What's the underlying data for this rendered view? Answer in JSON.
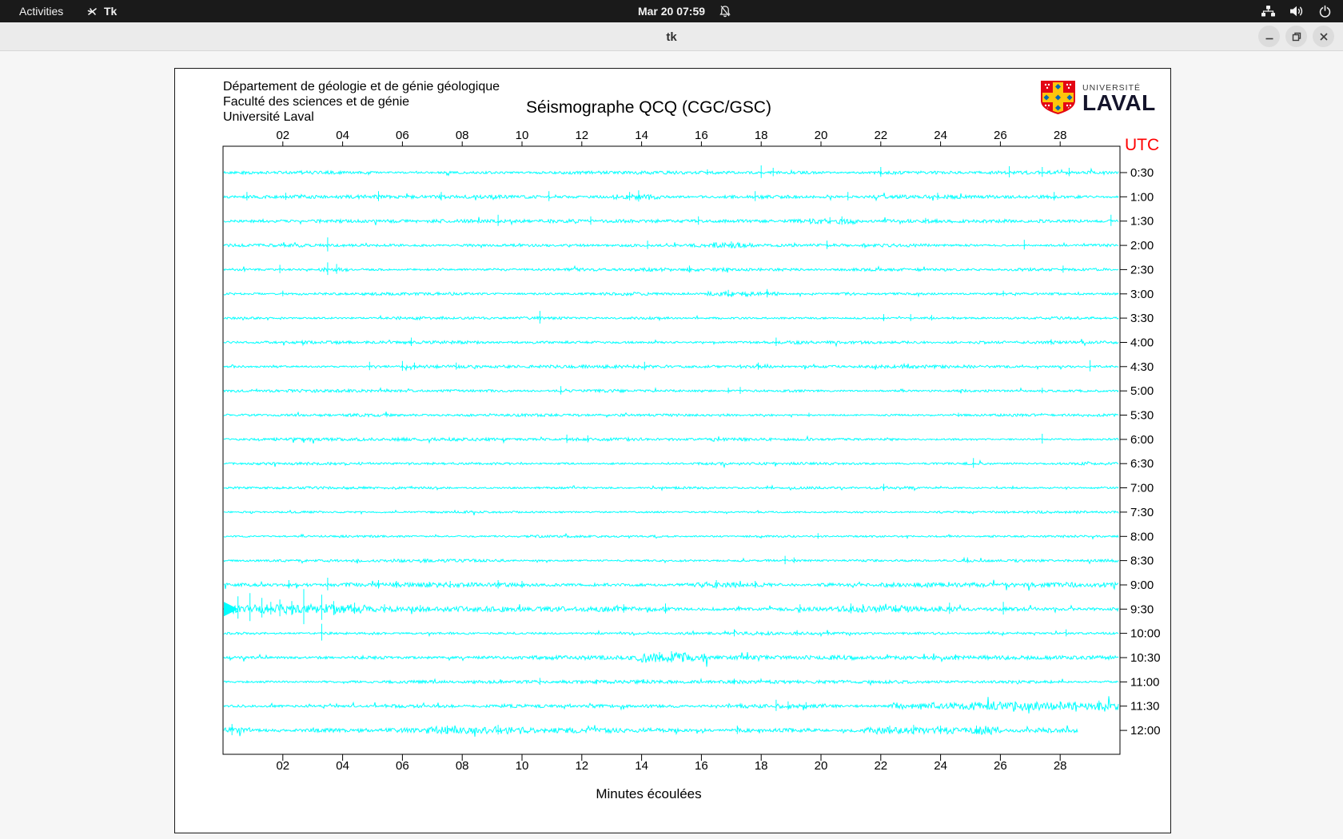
{
  "topbar": {
    "activities": "Activities",
    "app_name": "Tk",
    "clock": "Mar 20 07:59",
    "icons": [
      "tk-app-icon",
      "bell-muted-icon",
      "network-icon",
      "volume-icon",
      "power-icon"
    ]
  },
  "window": {
    "title": "tk",
    "buttons": [
      "minimize",
      "restore",
      "close"
    ]
  },
  "seismograph": {
    "org_lines": [
      "Département de géologie et de génie géologique",
      "Faculté des sciences et de génie",
      "Université Laval"
    ],
    "title": "Séismographe QCQ (CGC/GSC)",
    "utc_label": "UTC",
    "xlabel": "Minutes écoulées",
    "logo": {
      "line1": "UNIVERSITÉ",
      "line2": "LAVAL"
    },
    "colors": {
      "trace": "#00ffff",
      "utc": "#ff0000",
      "logo_red": "#e30513",
      "logo_gold": "#ffc40c",
      "logo_blue": "#0067b1"
    }
  },
  "chart_data": {
    "type": "line",
    "subtype": "seismogram-helicorder",
    "title": "Séismographe QCQ (CGC/GSC)",
    "xlabel": "Minutes écoulées",
    "right_axis_label": "UTC",
    "x_axis": {
      "ticks": [
        "02",
        "04",
        "06",
        "08",
        "10",
        "12",
        "14",
        "16",
        "18",
        "20",
        "22",
        "24",
        "26",
        "28"
      ],
      "range_minutes": [
        0,
        30
      ]
    },
    "rows": [
      {
        "time": "0:30",
        "base_amp": 1.4,
        "spikes": [
          [
            16.2,
            4
          ],
          [
            18.0,
            9
          ],
          [
            18.4,
            6
          ],
          [
            22.0,
            7
          ],
          [
            26.3,
            8
          ],
          [
            27.4,
            7
          ],
          [
            28.3,
            6
          ]
        ],
        "boosts": []
      },
      {
        "time": "1:00",
        "base_amp": 1.5,
        "spikes": [
          [
            0.8,
            6
          ],
          [
            2.1,
            5
          ],
          [
            5.2,
            7
          ],
          [
            7.3,
            6
          ],
          [
            10.9,
            7
          ],
          [
            13.6,
            6
          ],
          [
            13.9,
            8
          ],
          [
            17.8,
            7
          ],
          [
            20.9,
            6
          ],
          [
            23.9,
            5
          ],
          [
            27.8,
            6
          ]
        ],
        "boosts": [
          [
            13.0,
            14.6,
            2.2
          ]
        ]
      },
      {
        "time": "1:30",
        "base_amp": 1.4,
        "spikes": [
          [
            9.2,
            8
          ],
          [
            12.3,
            6
          ],
          [
            15.9,
            6
          ],
          [
            20.3,
            5
          ],
          [
            20.7,
            6
          ],
          [
            23.5,
            4
          ],
          [
            29.7,
            8
          ]
        ],
        "boosts": [
          [
            19.6,
            21.2,
            2.2
          ]
        ]
      },
      {
        "time": "2:00",
        "base_amp": 1.4,
        "spikes": [
          [
            3.5,
            10
          ],
          [
            14.2,
            6
          ],
          [
            17.0,
            5
          ],
          [
            20.2,
            6
          ],
          [
            26.8,
            7
          ]
        ],
        "boosts": [
          [
            16.4,
            17.8,
            2.2
          ]
        ]
      },
      {
        "time": "2:30",
        "base_amp": 1.4,
        "spikes": [
          [
            1.9,
            6
          ],
          [
            3.5,
            9
          ],
          [
            3.8,
            7
          ],
          [
            15.6,
            5
          ],
          [
            28.1,
            5
          ]
        ],
        "boosts": [
          [
            3.2,
            4.2,
            1.5
          ]
        ]
      },
      {
        "time": "3:00",
        "base_amp": 1.4,
        "spikes": [
          [
            2.0,
            4
          ],
          [
            16.9,
            5
          ],
          [
            18.2,
            6
          ],
          [
            26.1,
            4
          ]
        ],
        "boosts": [
          [
            16.2,
            18.6,
            2.0
          ]
        ]
      },
      {
        "time": "3:30",
        "base_amp": 1.3,
        "spikes": [
          [
            10.6,
            9
          ],
          [
            22.1,
            5
          ],
          [
            23.0,
            5
          ],
          [
            23.7,
            4
          ]
        ],
        "boosts": []
      },
      {
        "time": "4:00",
        "base_amp": 1.3,
        "spikes": [
          [
            6.3,
            6
          ],
          [
            18.5,
            6
          ],
          [
            27.7,
            4
          ]
        ],
        "boosts": []
      },
      {
        "time": "4:30",
        "base_amp": 1.4,
        "spikes": [
          [
            4.9,
            6
          ],
          [
            6.0,
            7
          ],
          [
            6.4,
            5
          ],
          [
            7.8,
            5
          ],
          [
            14.1,
            6
          ],
          [
            17.9,
            5
          ],
          [
            29.0,
            8
          ]
        ],
        "boosts": [
          [
            17.2,
            18.4,
            2.0
          ]
        ]
      },
      {
        "time": "5:00",
        "base_amp": 1.3,
        "spikes": [
          [
            11.3,
            6
          ],
          [
            16.9,
            4
          ],
          [
            17.3,
            5
          ],
          [
            27.4,
            4
          ]
        ],
        "boosts": []
      },
      {
        "time": "5:30",
        "base_amp": 1.2,
        "spikes": [
          [
            19.6,
            3
          ],
          [
            24.6,
            3
          ]
        ],
        "boosts": []
      },
      {
        "time": "6:00",
        "base_amp": 1.3,
        "spikes": [
          [
            11.5,
            6
          ],
          [
            12.2,
            5
          ],
          [
            27.4,
            7
          ]
        ],
        "boosts": []
      },
      {
        "time": "6:30",
        "base_amp": 1.2,
        "spikes": [
          [
            25.1,
            7
          ]
        ],
        "boosts": []
      },
      {
        "time": "7:00",
        "base_amp": 1.2,
        "spikes": [
          [
            22.1,
            5
          ]
        ],
        "boosts": []
      },
      {
        "time": "7:30",
        "base_amp": 1.2,
        "spikes": [],
        "boosts": []
      },
      {
        "time": "8:00",
        "base_amp": 1.2,
        "spikes": [
          [
            19.9,
            4
          ]
        ],
        "boosts": []
      },
      {
        "time": "8:30",
        "base_amp": 1.3,
        "spikes": [
          [
            18.8,
            6
          ],
          [
            19.1,
            4
          ],
          [
            24.9,
            4
          ]
        ],
        "boosts": []
      },
      {
        "time": "9:00",
        "base_amp": 2.0,
        "spikes": [
          [
            2.2,
            6
          ],
          [
            3.5,
            9
          ],
          [
            5.2,
            6
          ],
          [
            5.8,
            5
          ],
          [
            6.9,
            4
          ],
          [
            7.6,
            5
          ],
          [
            9.2,
            6
          ],
          [
            10.0,
            5
          ],
          [
            16.5,
            6
          ],
          [
            17.8,
            5
          ]
        ],
        "boosts": [
          [
            15.8,
            17.2,
            1.5
          ]
        ]
      },
      {
        "time": "9:30",
        "base_amp": 2.2,
        "blob": true,
        "spikes": [
          [
            0.5,
            16
          ],
          [
            0.9,
            20
          ],
          [
            1.3,
            14
          ],
          [
            1.6,
            9
          ],
          [
            1.9,
            12
          ],
          [
            2.3,
            10
          ],
          [
            2.7,
            25
          ],
          [
            3.3,
            18
          ],
          [
            3.7,
            10
          ],
          [
            4.4,
            8
          ],
          [
            5.4,
            6
          ],
          [
            6.6,
            5
          ],
          [
            13.4,
            6
          ],
          [
            14.8,
            7
          ],
          [
            19.3,
            6
          ],
          [
            21.0,
            7
          ],
          [
            21.4,
            6
          ],
          [
            22.5,
            5
          ],
          [
            24.3,
            8
          ],
          [
            26.1,
            9
          ]
        ],
        "boosts": [
          [
            0.0,
            4.8,
            3.5
          ],
          [
            20.5,
            24.5,
            2.0
          ]
        ]
      },
      {
        "time": "10:00",
        "base_amp": 1.4,
        "spikes": [
          [
            3.3,
            12
          ],
          [
            17.1,
            5
          ],
          [
            19.2,
            4
          ],
          [
            28.2,
            5
          ]
        ],
        "boosts": []
      },
      {
        "time": "10:30",
        "base_amp": 1.8,
        "spikes": [
          [
            14.6,
            7
          ],
          [
            15.0,
            8
          ],
          [
            15.4,
            6
          ],
          [
            24.5,
            4
          ]
        ],
        "boosts": [
          [
            13.8,
            16.2,
            4.5
          ]
        ]
      },
      {
        "time": "11:00",
        "base_amp": 1.4,
        "spikes": [
          [
            10.6,
            5
          ],
          [
            12.5,
            3
          ],
          [
            17.1,
            4
          ]
        ],
        "boosts": []
      },
      {
        "time": "11:30",
        "base_amp": 1.8,
        "spikes": [
          [
            18.5,
            8
          ],
          [
            18.9,
            6
          ],
          [
            19.5,
            5
          ],
          [
            26.5,
            6
          ],
          [
            28.0,
            6
          ],
          [
            29.3,
            7
          ]
        ],
        "boosts": [
          [
            16.8,
            20.2,
            1.8
          ],
          [
            22.3,
            30.0,
            3.2
          ]
        ]
      },
      {
        "time": "12:00",
        "base_amp": 2.2,
        "end_minute": 28.6,
        "spikes": [
          [
            0.3,
            8
          ],
          [
            7.5,
            6
          ],
          [
            9.2,
            7
          ],
          [
            17.2,
            6
          ],
          [
            22.3,
            6
          ],
          [
            23.1,
            7
          ],
          [
            24.0,
            6
          ],
          [
            25.2,
            6
          ]
        ],
        "boosts": [
          [
            0.0,
            1.0,
            2.0
          ],
          [
            6.8,
            10.2,
            2.5
          ],
          [
            21.5,
            26.0,
            3.0
          ]
        ]
      }
    ]
  }
}
